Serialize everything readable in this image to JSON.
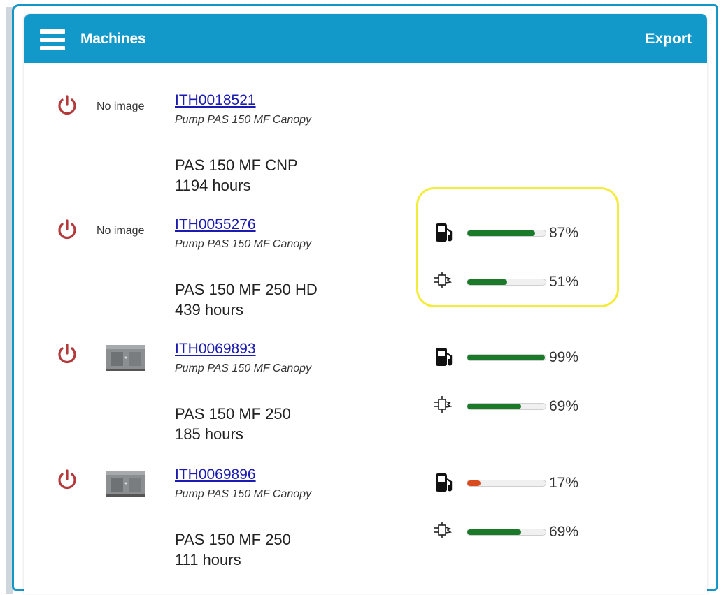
{
  "header": {
    "title": "Machines",
    "export_label": "Export"
  },
  "colors": {
    "header": "#1399c9",
    "bar_ok": "#1a7a2a",
    "bar_low": "#d94a1e",
    "power": "#b3393a"
  },
  "machines": [
    {
      "id": "ITH0018521",
      "description": "Pump PAS 150 MF Canopy",
      "image": "No image",
      "model": "PAS 150 MF CNP",
      "hours": "1194 hours"
    },
    {
      "id": "ITH0055276",
      "description": "Pump PAS 150 MF Canopy",
      "image": "No image",
      "model": "PAS 150 MF 250 HD",
      "hours": "439 hours",
      "fuel": {
        "value": 0.87,
        "label": "87%"
      },
      "other": {
        "value": 0.51,
        "label": "51%"
      }
    },
    {
      "id": "ITH0069893",
      "description": "Pump PAS 150 MF Canopy",
      "image": "machine-thumbnail",
      "model": "PAS 150 MF 250",
      "hours": "185 hours",
      "fuel": {
        "value": 0.99,
        "label": "99%"
      },
      "other": {
        "value": 0.69,
        "label": "69%"
      }
    },
    {
      "id": "ITH0069896",
      "description": "Pump PAS 150 MF Canopy",
      "image": "machine-thumbnail",
      "model": "PAS 150 MF 250",
      "hours": "111 hours",
      "fuel": {
        "value": 0.17,
        "label": "17%"
      },
      "other": {
        "value": 0.69,
        "label": "69%"
      }
    }
  ]
}
